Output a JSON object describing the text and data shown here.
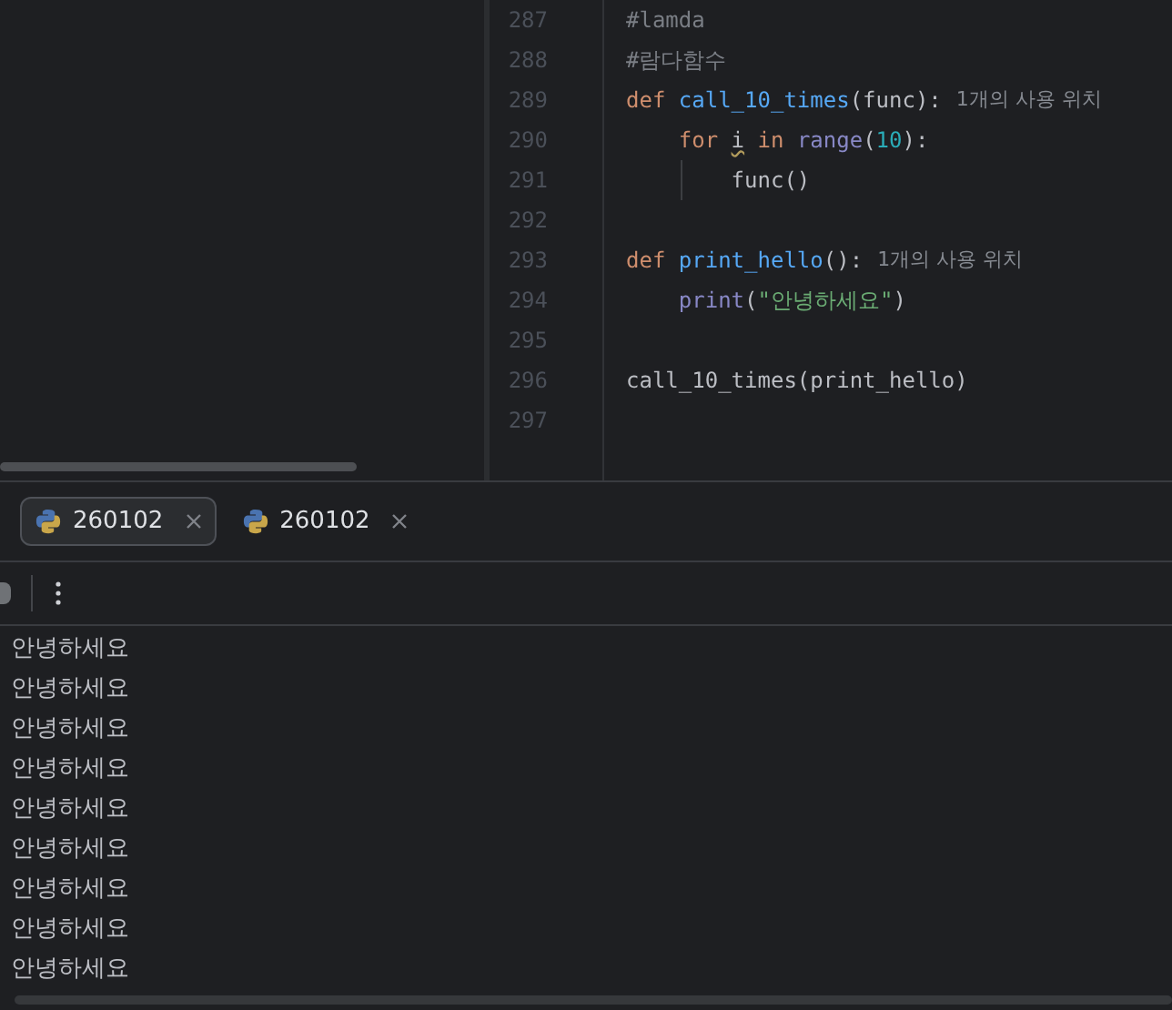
{
  "editor": {
    "lines": [
      {
        "number": "287",
        "tokens": [
          {
            "text": "#lamda",
            "kind": "comment"
          }
        ]
      },
      {
        "number": "288",
        "tokens": [
          {
            "text": "#람다함수",
            "kind": "comment"
          }
        ]
      },
      {
        "number": "289",
        "tokens": [
          {
            "text": "def ",
            "kind": "keyword"
          },
          {
            "text": "call_10_times",
            "kind": "function"
          },
          {
            "text": "(func):",
            "kind": "plain"
          }
        ],
        "hint": "1개의 사용 위치"
      },
      {
        "number": "290",
        "tokens": [
          {
            "text": "    for ",
            "kind": "keyword"
          },
          {
            "text": "i",
            "kind": "warning"
          },
          {
            "text": " in ",
            "kind": "keyword"
          },
          {
            "text": "range",
            "kind": "builtin"
          },
          {
            "text": "(",
            "kind": "plain"
          },
          {
            "text": "10",
            "kind": "number"
          },
          {
            "text": "):",
            "kind": "plain"
          }
        ]
      },
      {
        "number": "291",
        "tokens": [
          {
            "text": "        func()",
            "kind": "plain"
          }
        ]
      },
      {
        "number": "292"
      },
      {
        "number": "293",
        "tokens": [
          {
            "text": "def ",
            "kind": "keyword"
          },
          {
            "text": "print_hello",
            "kind": "function"
          },
          {
            "text": "():",
            "kind": "plain"
          }
        ],
        "hint": "1개의 사용 위치"
      },
      {
        "number": "294",
        "tokens": [
          {
            "text": "    print",
            "kind": "builtin"
          },
          {
            "text": "(",
            "kind": "plain"
          },
          {
            "text": "\"안녕하세요\"",
            "kind": "string"
          },
          {
            "text": ")",
            "kind": "plain"
          }
        ]
      },
      {
        "number": "295"
      },
      {
        "number": "296",
        "tokens": [
          {
            "text": "call_10_times(print_hello)",
            "kind": "plain"
          }
        ]
      },
      {
        "number": "297"
      }
    ]
  },
  "run_tabs": [
    {
      "label": "260102",
      "selected": true
    },
    {
      "label": "260102",
      "selected": false
    }
  ],
  "console": {
    "lines": [
      "안녕하세요",
      "안녕하세요",
      "안녕하세요",
      "안녕하세요",
      "안녕하세요",
      "안녕하세요",
      "안녕하세요",
      "안녕하세요",
      "안녕하세요"
    ]
  }
}
